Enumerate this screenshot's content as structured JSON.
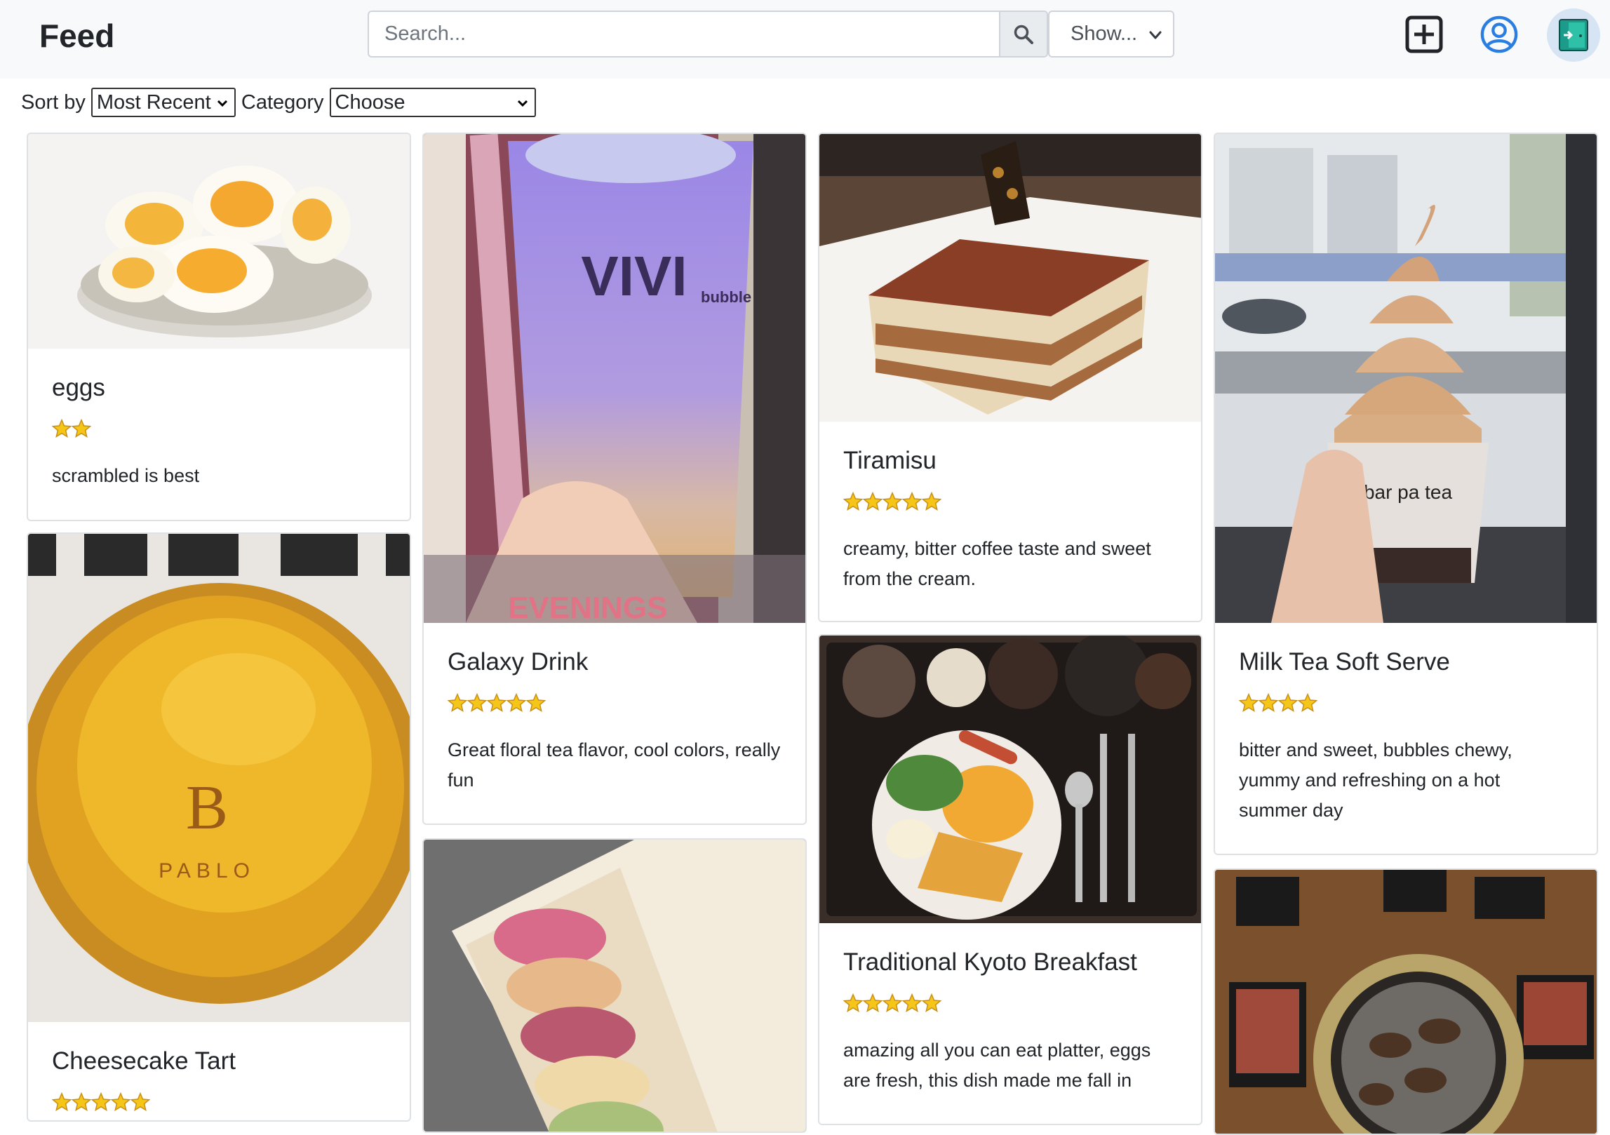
{
  "navbar": {
    "brand": "Feed",
    "search_placeholder": "Search...",
    "show_label": "Show...",
    "add_icon": "plus-square-icon",
    "profile_icon": "user-circle-icon",
    "exit_icon": "exit-door-icon"
  },
  "filters": {
    "sort_label": "Sort by",
    "sort_value": "Most Recent",
    "category_label": "Category",
    "category_value": "Choose"
  },
  "colors": {
    "star_fill": "#f5c518",
    "star_stroke": "#c8901a",
    "accent_blue": "#2a7de1"
  },
  "posts": [
    {
      "title": "eggs",
      "rating": 2,
      "text": "scrambled is best",
      "image": "boiled-eggs-plate"
    },
    {
      "title": "Cheesecake Tart",
      "rating": 5,
      "text": "",
      "image": "cheesecake-tart"
    },
    {
      "title": "Galaxy Drink",
      "rating": 5,
      "text": "Great floral tea flavor, cool colors, really fun",
      "image": "galaxy-bubble-drink"
    },
    {
      "title": "",
      "rating": 0,
      "text": "",
      "image": "macarons-box"
    },
    {
      "title": "Tiramisu",
      "rating": 5,
      "text": "creamy, bitter coffee taste and sweet from the cream.",
      "image": "tiramisu-slice"
    },
    {
      "title": "Traditional Kyoto Breakfast",
      "rating": 5,
      "text": "amazing all you can eat platter, eggs are fresh, this dish made me fall in",
      "image": "kyoto-breakfast-tray"
    },
    {
      "title": "Milk Tea Soft Serve",
      "rating": 4,
      "text": "bitter and sweet, bubbles chewy, yummy and refreshing on a hot summer day",
      "image": "soft-serve-cup"
    },
    {
      "title": "",
      "rating": 0,
      "text": "",
      "image": "korean-bbq-grill"
    }
  ]
}
